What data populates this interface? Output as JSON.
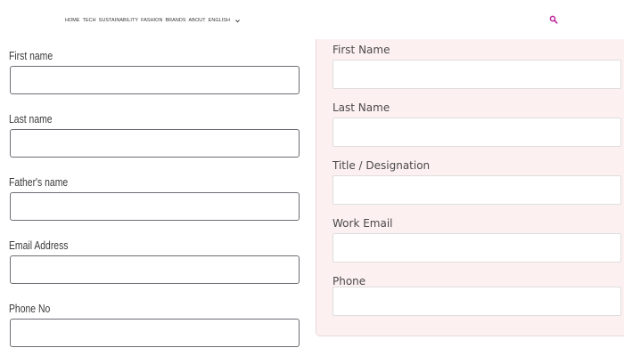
{
  "nav": {
    "items": [
      "HOME",
      "TECH",
      "SUSTAINABILITY",
      "FASHION",
      "BRANDS",
      "ABOUT",
      "ENGLISH"
    ],
    "language_dropdown_icon": "chevron-down-icon",
    "search_icon": "search-icon",
    "accent_color": "#c0289b"
  },
  "left_form": {
    "fields": [
      {
        "label": "First name",
        "value": ""
      },
      {
        "label": "Last name",
        "value": ""
      },
      {
        "label": "Father's name",
        "value": ""
      },
      {
        "label": "Email Address",
        "value": ""
      },
      {
        "label": "Phone No",
        "value": ""
      }
    ]
  },
  "right_form": {
    "background_color": "#fdf0f1",
    "fields": [
      {
        "label": "First Name",
        "value": ""
      },
      {
        "label": "Last Name",
        "value": ""
      },
      {
        "label": "Title / Designation",
        "value": ""
      },
      {
        "label": "Work Email",
        "value": ""
      },
      {
        "label": "Phone",
        "value": ""
      }
    ]
  }
}
